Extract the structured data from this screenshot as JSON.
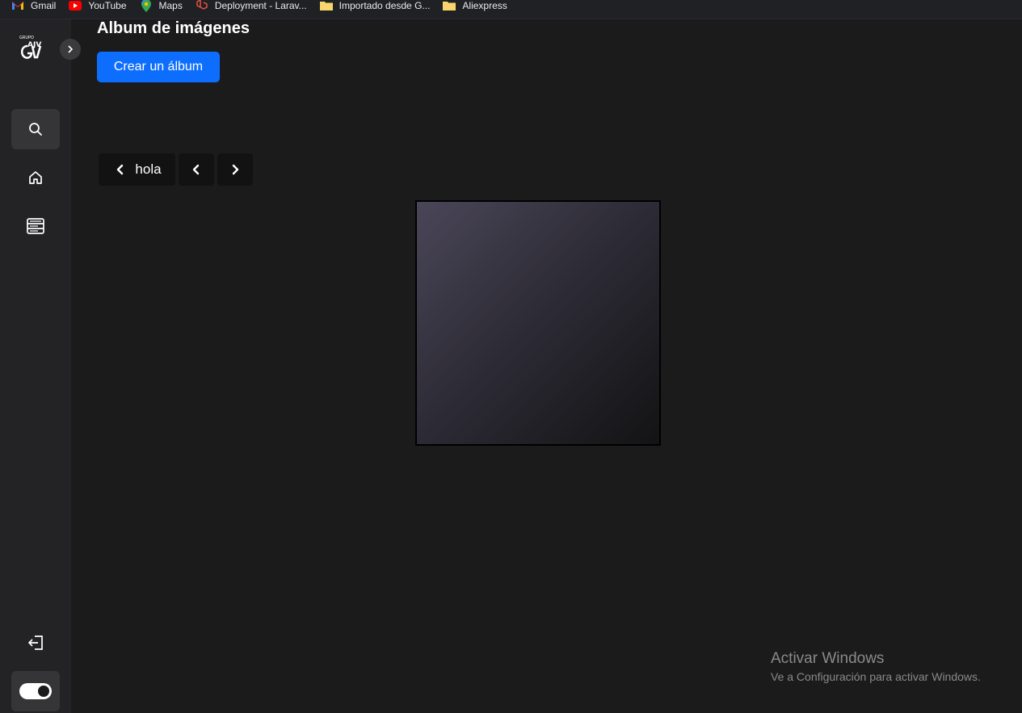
{
  "bookmarks": [
    {
      "label": "Gmail",
      "icon": "gmail-icon"
    },
    {
      "label": "YouTube",
      "icon": "youtube-icon"
    },
    {
      "label": "Maps",
      "icon": "maps-icon"
    },
    {
      "label": "Deployment - Larav...",
      "icon": "laravel-icon"
    },
    {
      "label": "Importado desde G...",
      "icon": "folder-icon"
    },
    {
      "label": "Aliexpress",
      "icon": "folder-icon"
    }
  ],
  "sidebar": {
    "logo_text_top": "GRUPO",
    "logo_text": "AJV",
    "items": [
      {
        "name": "search",
        "icon": "search-icon"
      },
      {
        "name": "home",
        "icon": "home-icon"
      },
      {
        "name": "list",
        "icon": "list-icon"
      }
    ],
    "logout_icon": "logout-icon",
    "theme_toggle_on": true
  },
  "main": {
    "title": "Album de imágenes",
    "create_button": "Crear un álbum",
    "back_label": "hola"
  },
  "watermark": {
    "title": "Activar Windows",
    "subtitle": "Ve a Configuración para activar Windows."
  },
  "colors": {
    "accent": "#0d6efd",
    "background": "#1b1b1c",
    "sidebar": "#232325"
  }
}
